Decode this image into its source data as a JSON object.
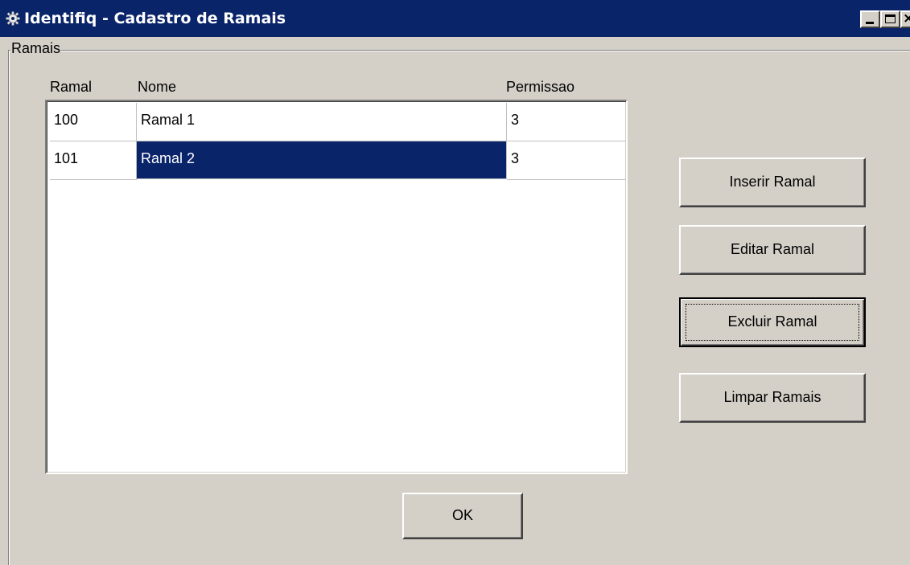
{
  "window": {
    "title": "Identifiq - Cadastro de Ramais",
    "controls": {
      "minimize": "minimize-icon",
      "maximize": "maximize-icon",
      "close": "close-icon"
    }
  },
  "group": {
    "label": "Ramais"
  },
  "list": {
    "columns": [
      "Ramal",
      "Nome",
      "Permissao"
    ],
    "rows": [
      {
        "ramal": "100",
        "nome": "Ramal 1",
        "permissao": "3",
        "selected": false
      },
      {
        "ramal": "101",
        "nome": "Ramal 2",
        "permissao": "3",
        "selected": true
      }
    ]
  },
  "actions": {
    "insert": "Inserir Ramal",
    "edit": "Editar Ramal",
    "delete": "Excluir Ramal",
    "clear": "Limpar Ramais",
    "ok": "OK"
  },
  "colors": {
    "titlebar": "#0a246a",
    "face": "#d4d0c8",
    "selection": "#0a246a"
  }
}
